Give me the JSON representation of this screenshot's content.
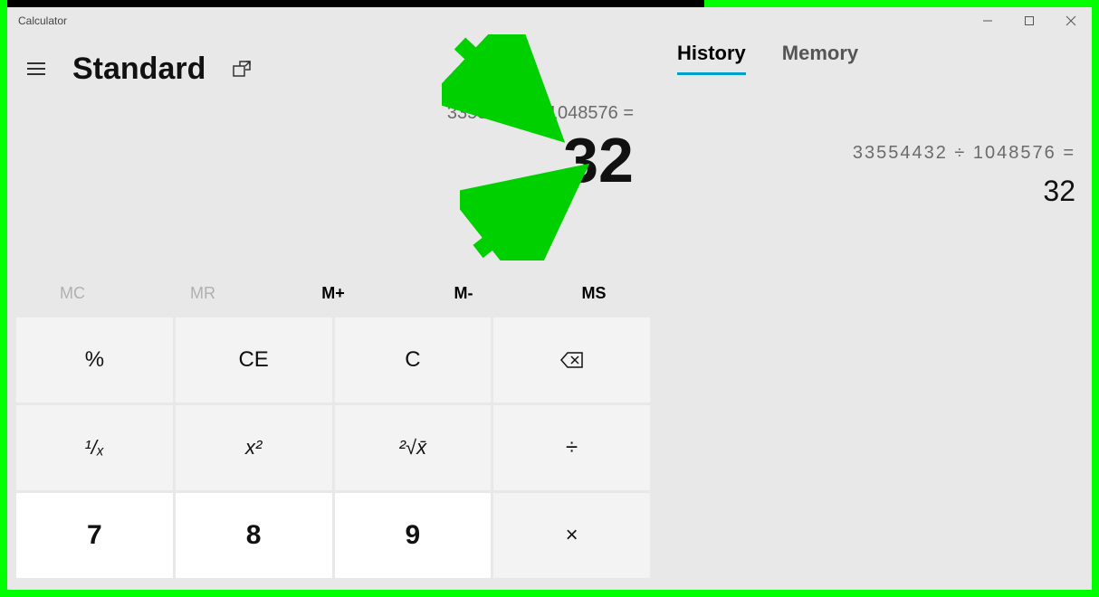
{
  "window": {
    "title": "Calculator"
  },
  "header": {
    "mode": "Standard"
  },
  "tabs": {
    "history": "History",
    "memory": "Memory",
    "active": "history"
  },
  "display": {
    "expression": "33554432 ÷ 1048576 =",
    "result": "32"
  },
  "memoryButtons": {
    "mc": "MC",
    "mr": "MR",
    "mplus": "M+",
    "mminus": "M-",
    "ms": "MS"
  },
  "keys": {
    "percent": "%",
    "ce": "CE",
    "c": "C",
    "reciprocal": "⅟ₓ",
    "square": "x²",
    "sqrt": "²√x",
    "divide": "÷",
    "seven": "7",
    "eight": "8",
    "nine": "9",
    "multiply": "×"
  },
  "history": [
    {
      "expression": "33554432  ÷  1048576 =",
      "result": "32"
    }
  ]
}
